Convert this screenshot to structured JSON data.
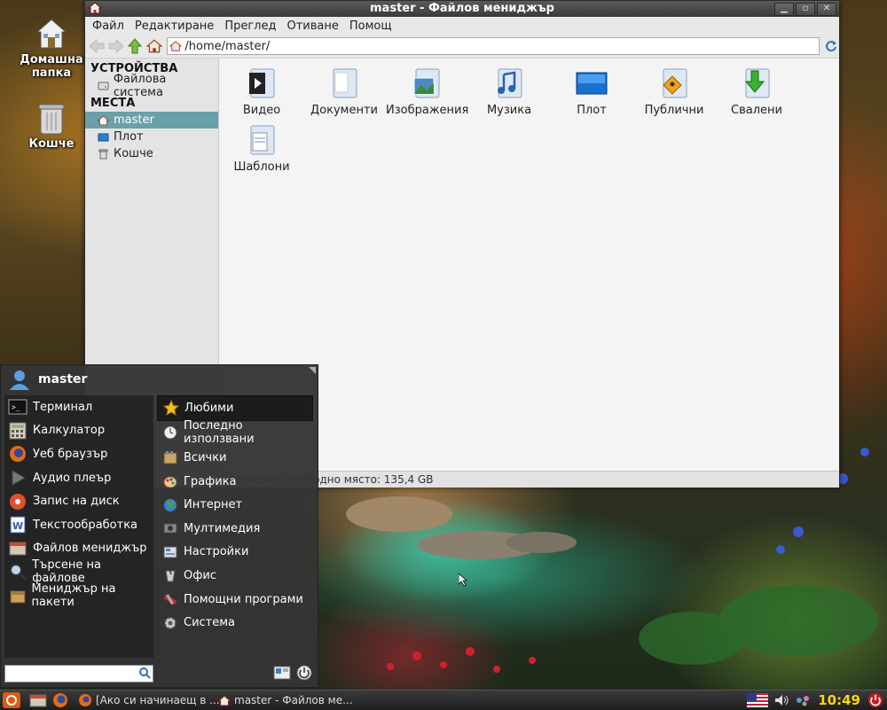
{
  "desktop": {
    "icons": [
      {
        "label": "Домашна папка",
        "icon": "home-folder-icon"
      },
      {
        "label": "Кошче",
        "icon": "trash-icon"
      }
    ]
  },
  "window": {
    "title": "master - Файлов мениджър",
    "menu": [
      "Файл",
      "Редактиране",
      "Преглед",
      "Отиване",
      "Помощ"
    ],
    "address": "/home/master/",
    "sidebar": {
      "devices_header": "УСТРОЙСТВА",
      "devices": [
        {
          "label": "Файлова система",
          "icon": "drive-icon"
        }
      ],
      "places_header": "МЕСТА",
      "places": [
        {
          "label": "master",
          "icon": "home-icon",
          "active": true
        },
        {
          "label": "Плот",
          "icon": "desktop-icon"
        },
        {
          "label": "Кошче",
          "icon": "trash-icon"
        }
      ]
    },
    "files": [
      {
        "label": "Видео",
        "icon": "video-folder-icon"
      },
      {
        "label": "Документи",
        "icon": "documents-folder-icon"
      },
      {
        "label": "Изображения",
        "icon": "pictures-folder-icon"
      },
      {
        "label": "Музика",
        "icon": "music-folder-icon"
      },
      {
        "label": "Плот",
        "icon": "desktop-folder-icon"
      },
      {
        "label": "Публични",
        "icon": "public-folder-icon"
      },
      {
        "label": "Свалени",
        "icon": "downloads-folder-icon"
      },
      {
        "label": "Шаблони",
        "icon": "templates-folder-icon"
      }
    ],
    "status": "елемента, свободно място: 135,4 GB"
  },
  "app_menu": {
    "user": "master",
    "apps": [
      {
        "label": "Терминал",
        "icon": "terminal-icon"
      },
      {
        "label": "Калкулатор",
        "icon": "calculator-icon"
      },
      {
        "label": "Уеб браузър",
        "icon": "firefox-icon"
      },
      {
        "label": "Аудио плеър",
        "icon": "audio-player-icon"
      },
      {
        "label": "Запис на диск",
        "icon": "disc-burner-icon"
      },
      {
        "label": "Текстообработка",
        "icon": "word-processor-icon"
      },
      {
        "label": "Файлов мениджър",
        "icon": "file-manager-icon"
      },
      {
        "label": "Търсене на файлове",
        "icon": "search-icon"
      },
      {
        "label": "Мениджър на пакети",
        "icon": "package-manager-icon"
      }
    ],
    "categories": [
      {
        "label": "Любими",
        "icon": "star-icon",
        "selected": true
      },
      {
        "label": "Последно използвани",
        "icon": "clock-icon"
      },
      {
        "label": "Всички",
        "icon": "all-apps-icon"
      },
      {
        "label": "Графика",
        "icon": "graphics-icon"
      },
      {
        "label": "Интернет",
        "icon": "globe-icon"
      },
      {
        "label": "Мултимедия",
        "icon": "multimedia-icon"
      },
      {
        "label": "Настройки",
        "icon": "settings-icon"
      },
      {
        "label": "Офис",
        "icon": "office-icon"
      },
      {
        "label": "Помощни програми",
        "icon": "utilities-icon"
      },
      {
        "label": "Система",
        "icon": "gear-icon"
      }
    ]
  },
  "taskbar": {
    "tasks": [
      {
        "label": "[Ако си начинаещ в ...",
        "icon": "firefox-icon"
      },
      {
        "label": "master - Файлов ме...",
        "icon": "home-icon"
      }
    ],
    "clock": "10:49"
  },
  "colors": {
    "accent": "#6aa0a8",
    "clock": "#ffd700"
  }
}
